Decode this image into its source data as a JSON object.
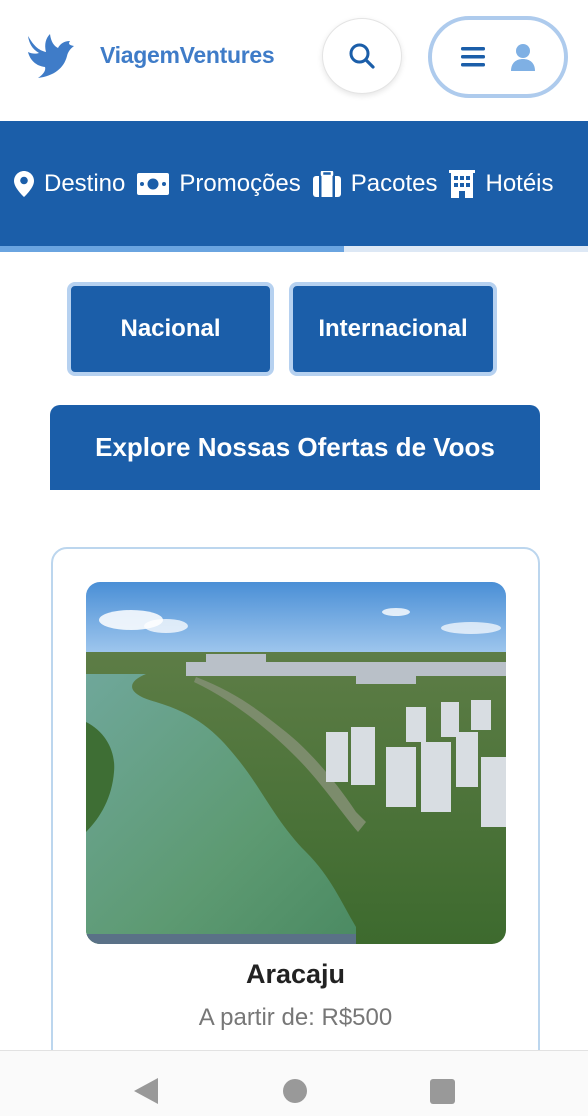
{
  "header": {
    "brand": "ViagemVentures",
    "logo_icon": "bird-icon",
    "search_icon": "search-icon",
    "menu_icon": "hamburger-icon",
    "user_icon": "user-icon"
  },
  "nav": {
    "items": [
      {
        "label": "Destino",
        "icon": "map-marker-icon"
      },
      {
        "label": "Promoções",
        "icon": "money-bill-icon"
      },
      {
        "label": "Pacotes",
        "icon": "suitcase-icon"
      },
      {
        "label": "Hotéis",
        "icon": "hotel-icon"
      }
    ],
    "scroll_progress": 0.585
  },
  "tabs": {
    "nacional": "Nacional",
    "internacional": "Internacional"
  },
  "explore": {
    "label": "Explore Nossas Ofertas de Voos"
  },
  "card": {
    "city": "Aracaju",
    "price": "A partir de: R$500"
  },
  "colors": {
    "primary": "#1b5ea9",
    "brand": "#3f7cc8",
    "accent_light": "#aecbed"
  }
}
